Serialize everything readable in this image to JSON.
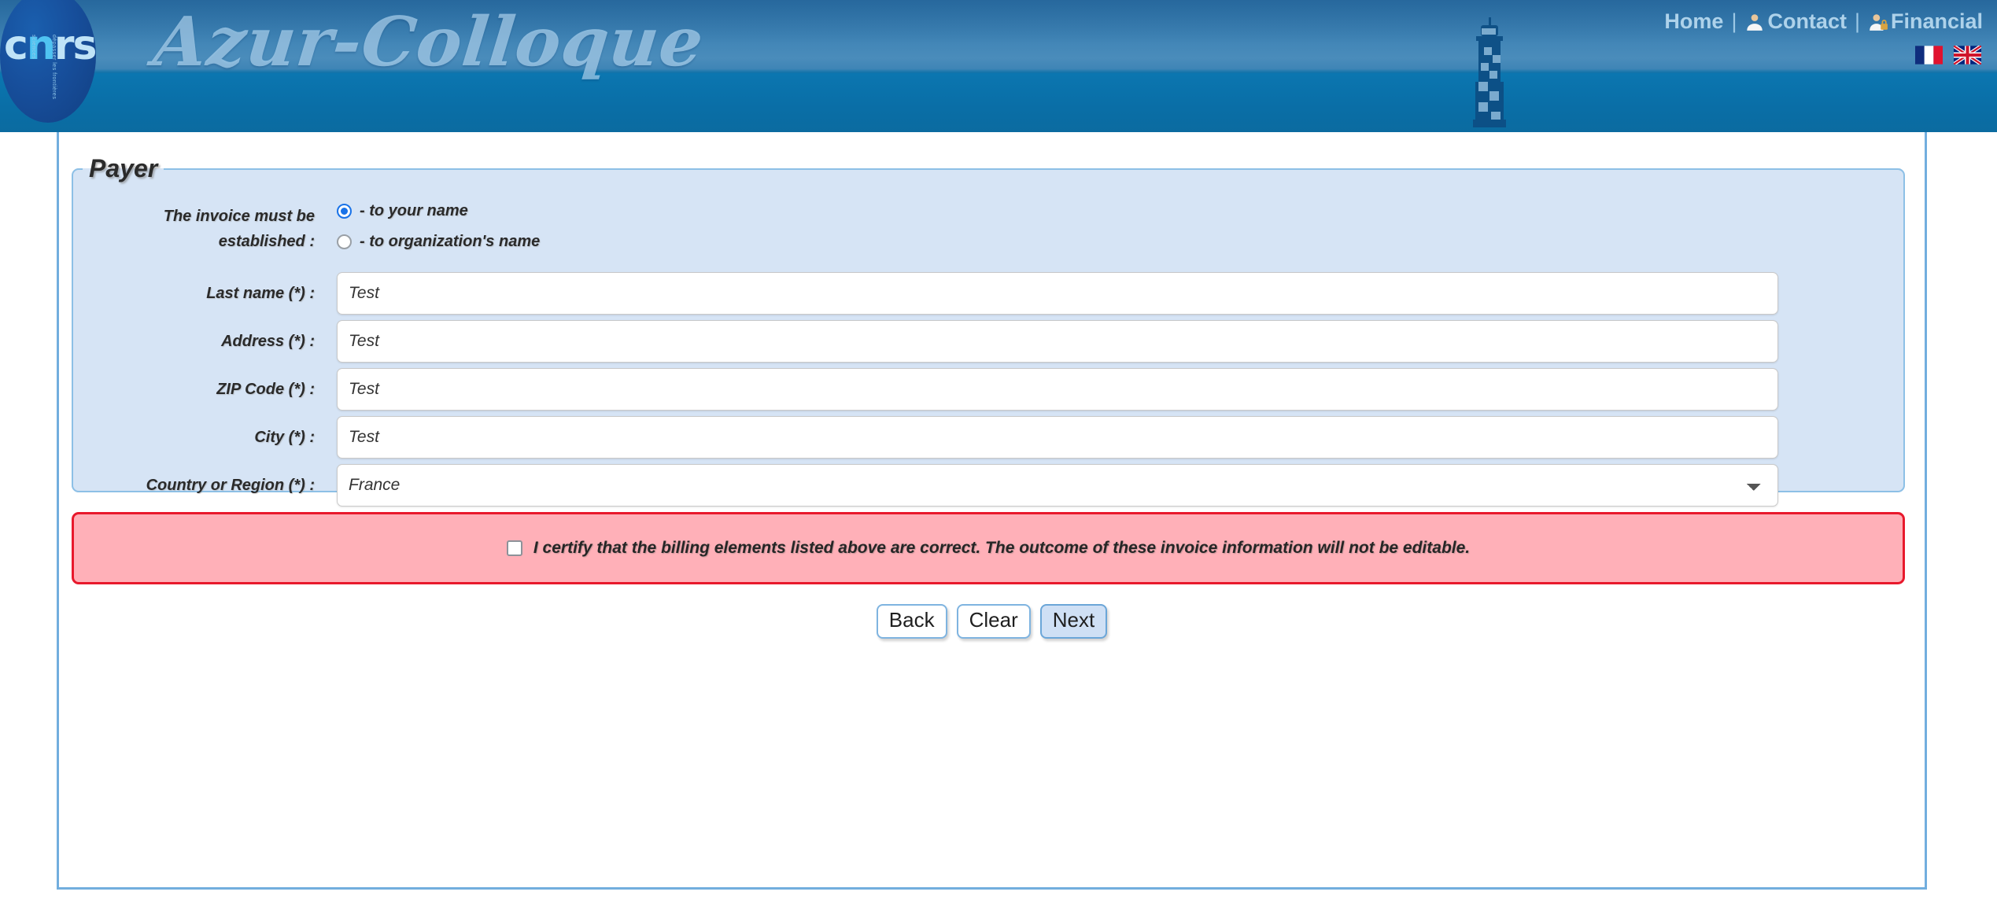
{
  "header": {
    "logo_text": "Azur-Colloque",
    "cnrs_mark": "cnrs",
    "cnrs_tagline_top": "sciences",
    "cnrs_tagline_bottom": "dépasser les frontières",
    "nav": [
      {
        "label": "Home",
        "icon": ""
      },
      {
        "label": "Contact",
        "icon": "user-icon"
      },
      {
        "label": "Financial",
        "icon": "user-lock-icon"
      }
    ],
    "separator": "|",
    "flags": [
      {
        "name": "flag-fr-icon",
        "title": "Français"
      },
      {
        "name": "flag-en-icon",
        "title": "English"
      }
    ]
  },
  "form": {
    "legend": "Payer",
    "invoice": {
      "label": "The invoice must be established :",
      "options": [
        {
          "label": "- to your name",
          "selected": true
        },
        {
          "label": "- to organization's name",
          "selected": false
        }
      ]
    },
    "fields": [
      {
        "label": "Last name (*) :",
        "value": "Test",
        "type": "text",
        "name": "last-name-input"
      },
      {
        "label": "Address (*) :",
        "value": "Test",
        "type": "text",
        "name": "address-input"
      },
      {
        "label": "ZIP Code (*) :",
        "value": "Test",
        "type": "text",
        "name": "zip-code-input"
      },
      {
        "label": "City (*) :",
        "value": "Test",
        "type": "text",
        "name": "city-input"
      },
      {
        "label": "Country or Region (*) :",
        "value": "France",
        "type": "select",
        "name": "country-select"
      }
    ],
    "certify": {
      "text": "I certify that the billing elements listed above are correct. The outcome of these invoice information will not be editable.",
      "checked": false
    },
    "buttons": [
      {
        "label": "Back",
        "name": "back-button",
        "active": false
      },
      {
        "label": "Clear",
        "name": "clear-button",
        "active": false
      },
      {
        "label": "Next",
        "name": "next-button",
        "active": true
      }
    ]
  },
  "colors": {
    "banner_blue": "#0d72aa",
    "panel_blue": "#d6e4f5",
    "panel_border": "#8dc0e6",
    "alert_pink": "#ffb0b8",
    "alert_border": "#e8192c",
    "accent_radio": "#1a73e8"
  }
}
